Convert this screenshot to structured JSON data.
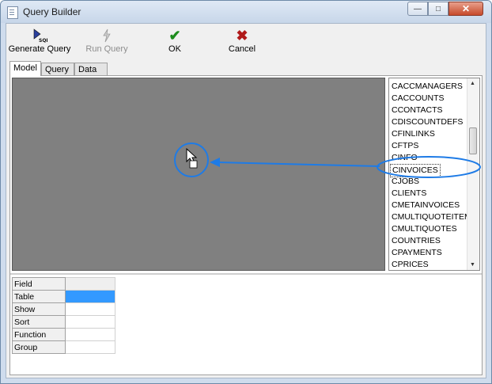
{
  "window": {
    "title": "Query Builder"
  },
  "window_controls": {
    "minimize": "—",
    "maximize": "□",
    "close": "✕"
  },
  "toolbar": {
    "generate_query": "Generate Query",
    "run_query": "Run Query",
    "ok": "OK",
    "cancel": "Cancel"
  },
  "tabs": [
    "Model",
    "Query",
    "Data"
  ],
  "table_list": {
    "items": [
      "CACCMANAGERS",
      "CACCOUNTS",
      "CCONTACTS",
      "CDISCOUNTDEFS",
      "CFINLINKS",
      "CFTPS",
      "CINFO",
      "CINVOICES",
      "CJOBS",
      "CLIENTS",
      "CMETAINVOICES",
      "CMULTIQUOTEITEMS",
      "CMULTIQUOTES",
      "COUNTRIES",
      "CPAYMENTS",
      "CPRICES"
    ],
    "selected": "CINVOICES"
  },
  "grid": {
    "rows": [
      "Field",
      "Table",
      "Show",
      "Sort",
      "Function",
      "Group"
    ]
  },
  "colors": {
    "accent": "#3399ff",
    "annotation": "#1e7be6",
    "canvas": "#808080"
  }
}
